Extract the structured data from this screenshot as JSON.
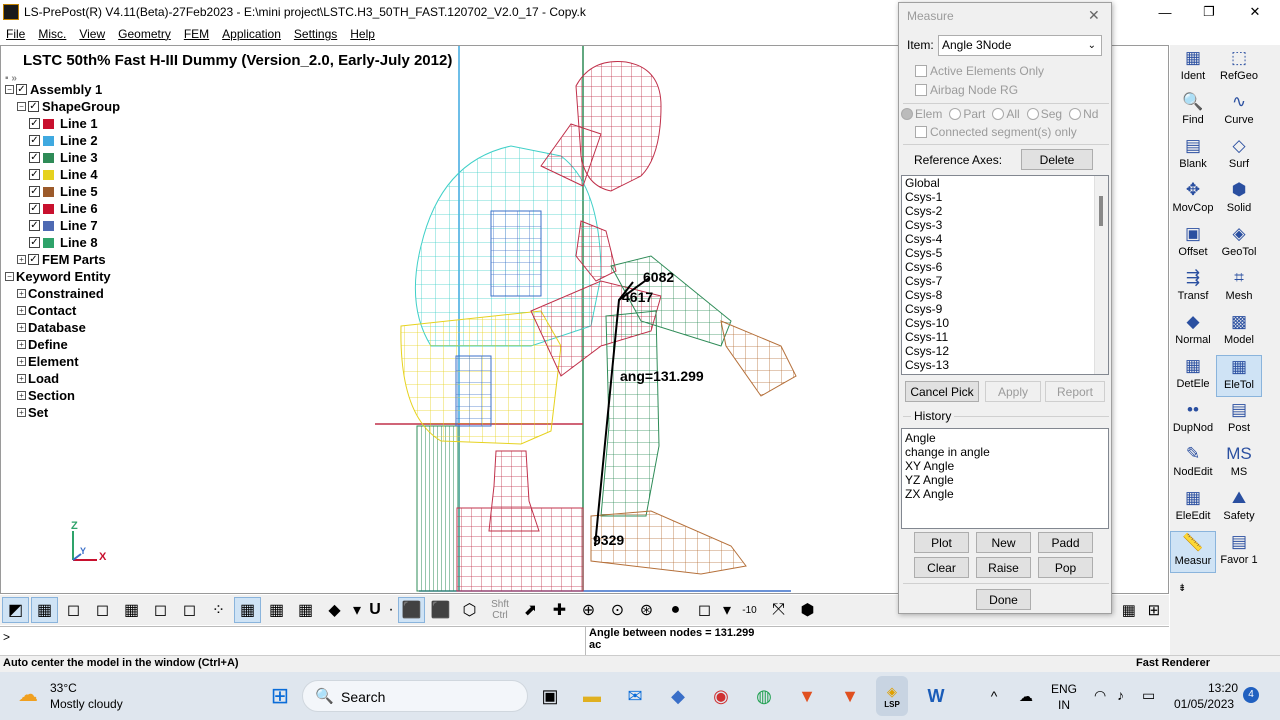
{
  "window": {
    "title": "LS-PrePost(R) V4.11(Beta)-27Feb2023 - E:\\mini project\\LSTC.H3_50TH_FAST.120702_V2.0_17 - Copy.k",
    "minimize": "—",
    "maximize": "❐",
    "close": "✕"
  },
  "menu": [
    "File",
    "Misc.",
    "View",
    "Geometry",
    "FEM",
    "Application",
    "Settings",
    "Help"
  ],
  "model_title": "LSTC 50th% Fast H-III Dummy (Version_2.0, Early-July 2012)",
  "tree": {
    "assembly": "Assembly 1",
    "shapegroup": "ShapeGroup",
    "lines": [
      {
        "label": "Line 1",
        "color": "#c8102e"
      },
      {
        "label": "Line 2",
        "color": "#3fa9e0"
      },
      {
        "label": "Line 3",
        "color": "#2e8b57"
      },
      {
        "label": "Line 4",
        "color": "#e6d21e"
      },
      {
        "label": "Line 5",
        "color": "#9c5a2a"
      },
      {
        "label": "Line 6",
        "color": "#c8102e"
      },
      {
        "label": "Line 7",
        "color": "#4e6ab3"
      },
      {
        "label": "Line 8",
        "color": "#2ea36a"
      }
    ],
    "fem_parts": "FEM Parts",
    "keyword_entity": "Keyword Entity",
    "keywords": [
      "Constrained",
      "Contact",
      "Database",
      "Define",
      "Element",
      "Load",
      "Section",
      "Set"
    ]
  },
  "annotations": {
    "node_top": "6082",
    "node_mid": "4617",
    "node_bottom": "9329",
    "angle": "ang=131.299"
  },
  "axis": {
    "z": "Z",
    "y": "Y",
    "x": "X"
  },
  "measure": {
    "title": "Measure",
    "item_label": "Item:",
    "item_value": "Angle 3Node",
    "active_elements": "Active Elements Only",
    "airbag_node": "Airbag Node RG",
    "radios": [
      "Elem",
      "Part",
      "All",
      "Seg",
      "Nd"
    ],
    "connected": "Connected segment(s) only",
    "reference_axes": "Reference Axes:",
    "delete": "Delete",
    "axes_list": [
      "Global",
      "Csys-1",
      "Csys-2",
      "Csys-3",
      "Csys-4",
      "Csys-5",
      "Csys-6",
      "Csys-7",
      "Csys-8",
      "Csys-9",
      "Csys-10",
      "Csys-11",
      "Csys-12",
      "Csys-13"
    ],
    "cancel_pick": "Cancel Pick",
    "apply": "Apply",
    "report": "Report",
    "history_label": "History",
    "history": [
      "Angle",
      "change in angle",
      "XY Angle",
      "YZ Angle",
      "ZX Angle"
    ],
    "plot": "Plot",
    "new": "New",
    "padd": "Padd",
    "clear": "Clear",
    "raise": "Raise",
    "pop": "Pop",
    "done": "Done"
  },
  "right_panel": [
    {
      "label": "Ident",
      "icon": "ident-icon",
      "glyph": "▦"
    },
    {
      "label": "RefGeo",
      "icon": "refgeo-icon",
      "glyph": "⬚"
    },
    {
      "label": "Find",
      "icon": "find-icon",
      "glyph": "🔍"
    },
    {
      "label": "Curve",
      "icon": "curve-icon",
      "glyph": "∿"
    },
    {
      "label": "Blank",
      "icon": "blank-icon",
      "glyph": "▤"
    },
    {
      "label": "Surf",
      "icon": "surf-icon",
      "glyph": "◇"
    },
    {
      "label": "MovCop",
      "icon": "movcop-icon",
      "glyph": "✥"
    },
    {
      "label": "Solid",
      "icon": "solid-icon",
      "glyph": "⬢"
    },
    {
      "label": "Offset",
      "icon": "offset-icon",
      "glyph": "▣"
    },
    {
      "label": "GeoTol",
      "icon": "geotol-icon",
      "glyph": "◈"
    },
    {
      "label": "Transf",
      "icon": "transf-icon",
      "glyph": "⇶"
    },
    {
      "label": "Mesh",
      "icon": "mesh-icon",
      "glyph": "⌗"
    },
    {
      "label": "Normal",
      "icon": "normal-icon",
      "glyph": "◆"
    },
    {
      "label": "Model",
      "icon": "model-icon",
      "glyph": "▩"
    },
    {
      "label": "DetEle",
      "icon": "detele-icon",
      "glyph": "▦"
    },
    {
      "label": "EleTol",
      "icon": "eletol-icon",
      "glyph": "▦"
    },
    {
      "label": "DupNod",
      "icon": "dupnod-icon",
      "glyph": "••"
    },
    {
      "label": "Post",
      "icon": "post-icon",
      "glyph": "▤"
    },
    {
      "label": "NodEdit",
      "icon": "nodedit-icon",
      "glyph": "✎"
    },
    {
      "label": "MS",
      "icon": "ms-icon",
      "glyph": "MS"
    },
    {
      "label": "EleEdit",
      "icon": "eleedit-icon",
      "glyph": "▦"
    },
    {
      "label": "Safety",
      "icon": "safety-icon",
      "glyph": "⛰"
    },
    {
      "label": "Measur",
      "icon": "measure-icon",
      "glyph": "📏"
    },
    {
      "label": "Favor 1",
      "icon": "favor-icon",
      "glyph": "▤"
    }
  ],
  "toolbar": {
    "shft": "Shft",
    "ctrl": "Ctrl",
    "neg10": "-10",
    "u_label": "U"
  },
  "command": {
    "prompt": ">",
    "output_line1": "Angle between nodes = 131.299",
    "output_line2": "ac"
  },
  "status": {
    "left": "Auto center the model in the window (Ctrl+A)",
    "right": "Fast Renderer"
  },
  "taskbar": {
    "temp": "33°C",
    "weather": "Mostly cloudy",
    "search": "Search",
    "lang1": "ENG",
    "lang2": "IN",
    "time": "13:20",
    "date": "01/05/2023",
    "notifications": "4",
    "lsp_label": "LSP"
  },
  "colors": {
    "head": "#c0304a",
    "torso": "#40d0c8",
    "legs": "#2e8b57",
    "pelvis": "#e6d21e",
    "foot": "#b5703a",
    "blue": "#3a6fc8"
  }
}
